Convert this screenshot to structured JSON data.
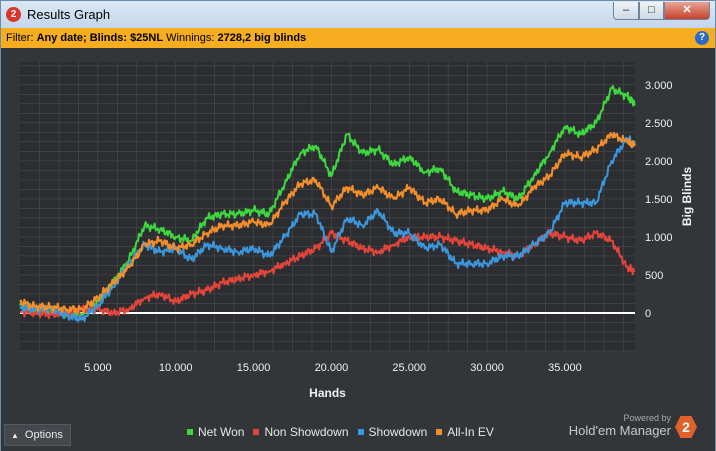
{
  "window": {
    "title": "Results Graph",
    "app_icon_label": "2",
    "controls": {
      "minimize": "–",
      "maximize": "□",
      "close": "✕"
    }
  },
  "filter": {
    "prefix": "Filter: ",
    "date": "Any date; Blinds: $25NL",
    "winnings_label": " Winnings: ",
    "winnings_value": "2728,2 big blinds",
    "help_label": "?"
  },
  "footer": {
    "options_label": "Options",
    "powered_by": "Powered by",
    "brand_name": "Hold'em Manager",
    "brand_logo_label": "2"
  },
  "colors": {
    "net_won": "#3fd73f",
    "non_showdown": "#e4453a",
    "showdown": "#3b96dc",
    "all_in_ev": "#f28e2b",
    "zero_line": "#ffffff",
    "grid": "#4a4d50"
  },
  "chart_data": {
    "type": "line",
    "xlabel": "Hands",
    "ylabel": "Big Blinds",
    "xlim": [
      0,
      39500
    ],
    "ylim": [
      -500,
      3300
    ],
    "x_ticks": [
      5000,
      10000,
      15000,
      20000,
      25000,
      30000,
      35000
    ],
    "x_tick_labels": [
      "5.000",
      "10.000",
      "15.000",
      "20.000",
      "25.000",
      "30.000",
      "35.000"
    ],
    "y_ticks": [
      0,
      500,
      1000,
      1500,
      2000,
      2500,
      3000
    ],
    "y_tick_labels": [
      "0",
      "500",
      "1.000",
      "1.500",
      "2.000",
      "2.500",
      "3.000"
    ],
    "grid": true,
    "legend_position": "bottom",
    "series": [
      {
        "name": "Net Won",
        "color_key": "net_won",
        "x": [
          0,
          1000,
          2000,
          3000,
          4000,
          5000,
          6000,
          7000,
          8000,
          9000,
          10000,
          11000,
          12000,
          13000,
          14000,
          15000,
          16000,
          17000,
          18000,
          19000,
          20000,
          21000,
          22000,
          23000,
          24000,
          25000,
          26000,
          27000,
          28000,
          29000,
          30000,
          31000,
          32000,
          33000,
          34000,
          35000,
          36000,
          37000,
          38000,
          39000,
          39500
        ],
        "y": [
          100,
          40,
          40,
          -20,
          -20,
          150,
          400,
          700,
          1150,
          1100,
          1000,
          950,
          1250,
          1300,
          1300,
          1350,
          1300,
          1700,
          2100,
          2200,
          1800,
          2350,
          2100,
          2150,
          1950,
          2050,
          1850,
          1900,
          1600,
          1550,
          1500,
          1600,
          1500,
          1800,
          2100,
          2450,
          2350,
          2500,
          2950,
          2850,
          2750
        ]
      },
      {
        "name": "Non Showdown",
        "color_key": "non_showdown",
        "x": [
          0,
          1000,
          2000,
          3000,
          4000,
          5000,
          6000,
          7000,
          8000,
          9000,
          10000,
          11000,
          12000,
          13000,
          14000,
          15000,
          16000,
          17000,
          18000,
          19000,
          20000,
          21000,
          22000,
          23000,
          24000,
          25000,
          26000,
          27000,
          28000,
          29000,
          30000,
          31000,
          32000,
          33000,
          34000,
          35000,
          36000,
          37000,
          38000,
          39000,
          39500
        ],
        "y": [
          20,
          0,
          -20,
          0,
          50,
          50,
          0,
          50,
          200,
          250,
          150,
          250,
          300,
          400,
          450,
          500,
          550,
          650,
          750,
          850,
          1050,
          950,
          850,
          800,
          900,
          1000,
          1000,
          1000,
          950,
          900,
          850,
          800,
          750,
          900,
          1050,
          1000,
          950,
          1050,
          950,
          600,
          550
        ]
      },
      {
        "name": "Showdown",
        "color_key": "showdown",
        "x": [
          0,
          1000,
          2000,
          3000,
          4000,
          5000,
          6000,
          7000,
          8000,
          9000,
          10000,
          11000,
          12000,
          13000,
          14000,
          15000,
          16000,
          17000,
          18000,
          19000,
          20000,
          21000,
          22000,
          23000,
          24000,
          25000,
          26000,
          27000,
          28000,
          29000,
          30000,
          31000,
          32000,
          33000,
          34000,
          35000,
          36000,
          37000,
          38000,
          39000,
          39500
        ],
        "y": [
          80,
          40,
          60,
          -40,
          -80,
          100,
          350,
          650,
          900,
          800,
          850,
          700,
          900,
          850,
          800,
          850,
          750,
          1000,
          1300,
          1300,
          800,
          1250,
          1150,
          1350,
          1050,
          1050,
          850,
          900,
          650,
          650,
          650,
          750,
          750,
          900,
          1050,
          1450,
          1450,
          1450,
          2000,
          2300,
          2200
        ]
      },
      {
        "name": "All-In EV",
        "color_key": "all_in_ev",
        "x": [
          0,
          1000,
          2000,
          3000,
          4000,
          5000,
          6000,
          7000,
          8000,
          9000,
          10000,
          11000,
          12000,
          13000,
          14000,
          15000,
          16000,
          17000,
          18000,
          19000,
          20000,
          21000,
          22000,
          23000,
          24000,
          25000,
          26000,
          27000,
          28000,
          29000,
          30000,
          31000,
          32000,
          33000,
          34000,
          35000,
          36000,
          37000,
          38000,
          39000,
          39500
        ],
        "y": [
          150,
          80,
          80,
          50,
          50,
          200,
          400,
          600,
          900,
          950,
          850,
          900,
          1050,
          1150,
          1150,
          1200,
          1150,
          1450,
          1700,
          1750,
          1400,
          1650,
          1550,
          1650,
          1500,
          1650,
          1450,
          1500,
          1300,
          1350,
          1350,
          1500,
          1400,
          1650,
          1800,
          2100,
          2050,
          2150,
          2350,
          2250,
          2200
        ]
      }
    ]
  }
}
